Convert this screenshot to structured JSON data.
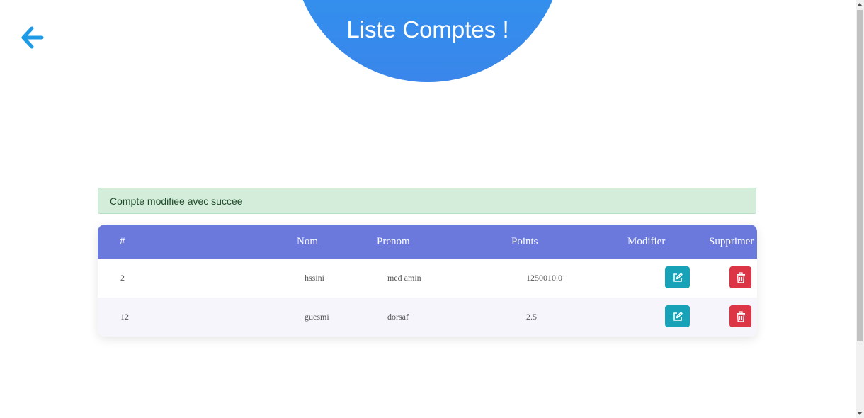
{
  "page": {
    "title": "Liste Comptes !"
  },
  "alert": {
    "message": "Compte modifiee avec succee"
  },
  "table": {
    "headers": [
      "#",
      "Nom",
      "Prenom",
      "Points",
      "Modifier",
      "Supprimer"
    ],
    "rows": [
      {
        "id": "2",
        "nom": "hssini",
        "prenom": "med amin",
        "points": "1250010.0"
      },
      {
        "id": "12",
        "nom": "guesmi",
        "prenom": "dorsaf",
        "points": "2.5"
      }
    ]
  },
  "colors": {
    "header_gradient_start": "#1ea6f2",
    "header_gradient_end": "#3a86ea",
    "table_header": "#6b79dd",
    "alert_bg": "#d4edda",
    "edit_button": "#17a2b8",
    "delete_button": "#dc3545",
    "back_arrow": "#1e9ae6"
  },
  "icons": {
    "back": "arrow-left-icon",
    "edit": "edit-icon",
    "delete": "trash-icon"
  }
}
